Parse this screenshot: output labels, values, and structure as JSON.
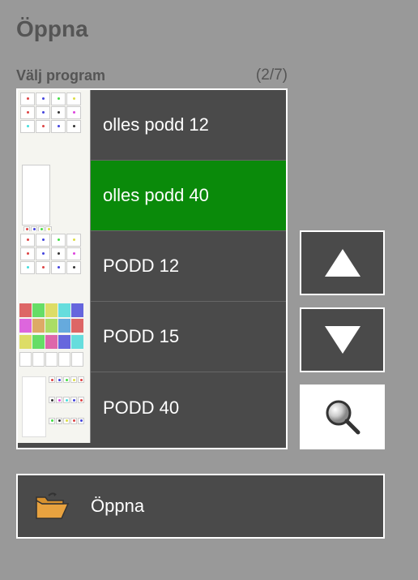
{
  "title": "Öppna",
  "subtitle": "Välj program",
  "counter": "(2/7)",
  "items": [
    {
      "label": "olles podd 12",
      "selected": false
    },
    {
      "label": "olles podd 40",
      "selected": true
    },
    {
      "label": "PODD 12",
      "selected": false
    },
    {
      "label": "PODD 15",
      "selected": false
    },
    {
      "label": "PODD 40",
      "selected": false
    }
  ],
  "open_button_label": "Öppna"
}
